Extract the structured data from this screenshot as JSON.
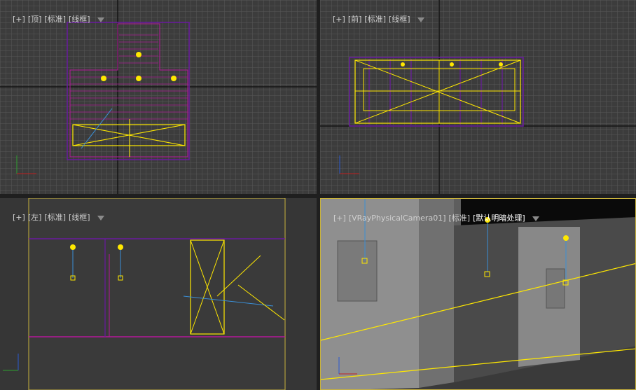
{
  "viewports": {
    "top": {
      "menu": "[+]",
      "view": "[顶]",
      "shading": "[标准]",
      "mode": "[线框]"
    },
    "front": {
      "menu": "[+]",
      "view": "[前]",
      "shading": "[标准]",
      "mode": "[线框]"
    },
    "left": {
      "menu": "[+]",
      "view": "[左]",
      "shading": "[标准]",
      "mode": "[线框]"
    },
    "camera": {
      "menu": "[+]",
      "view": "[VRayPhysicalCamera01]",
      "shading": "[标准]",
      "mode": "[默认明暗处理]"
    }
  },
  "colors": {
    "grid_bg": "#3c3c3c",
    "grid_line": "#5a5a5a",
    "axis_line": "#111111",
    "active_border": "#c8b23c",
    "light": "#ffe800",
    "wall": "#6a1aa0",
    "wall2": "#b4189a"
  },
  "icons": {
    "filter": "filter-icon",
    "axis": "axis-tripod-icon",
    "light": "light-icon",
    "camera": "camera-icon"
  }
}
